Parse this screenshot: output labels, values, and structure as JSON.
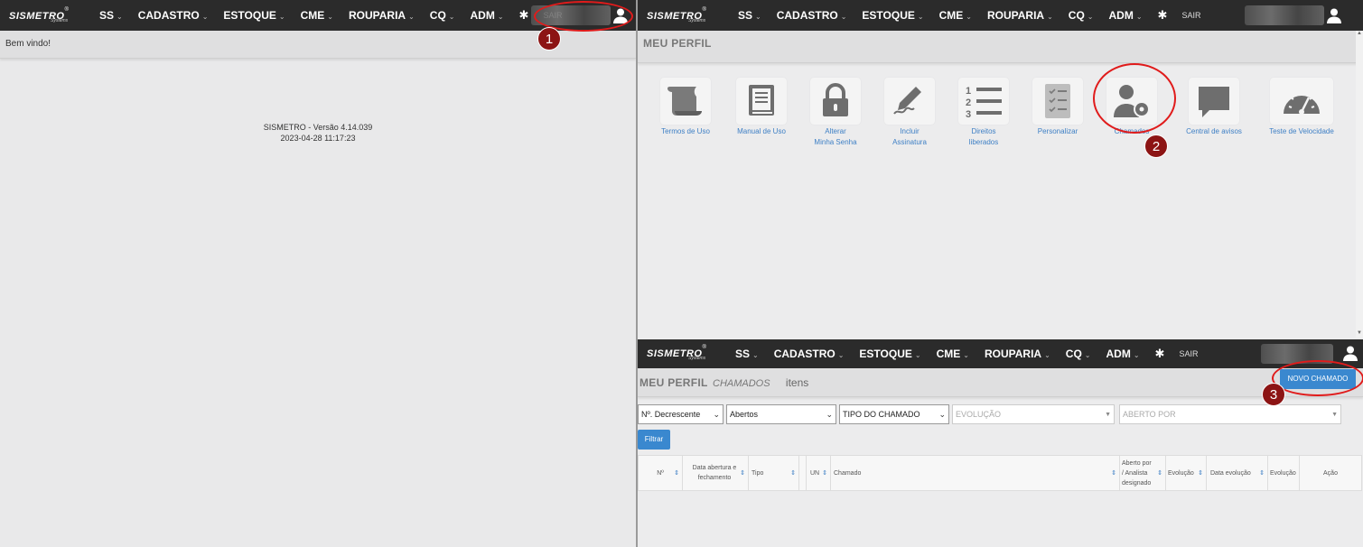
{
  "brand": {
    "name": "SISMETRO",
    "sub": "Systems",
    "reg": "®"
  },
  "nav": {
    "items": [
      "SS",
      "CADASTRO",
      "ESTOQUE",
      "CME",
      "ROUPARIA",
      "CQ",
      "ADM"
    ],
    "logout": "SAIR",
    "caret": "⌄",
    "gear": "✱"
  },
  "panel1": {
    "welcome": "Bem vindo!",
    "version_line1": "SISMETRO - Versão 4.14.039",
    "version_line2": "2023-04-28 11:17:23",
    "badge": "1"
  },
  "panel2": {
    "title": "MEU PERFIL",
    "tiles": [
      {
        "label1": "Termos de Uso",
        "label2": "",
        "icon": "scroll-icon"
      },
      {
        "label1": "Manual de Uso",
        "label2": "",
        "icon": "book-icon"
      },
      {
        "label1": "Alterar",
        "label2": "Minha Senha",
        "icon": "lock-icon"
      },
      {
        "label1": "Incluir",
        "label2": "Assinatura",
        "icon": "pen-icon"
      },
      {
        "label1": "Direitos",
        "label2": "liberados",
        "icon": "numbered-list-icon"
      },
      {
        "label1": "Personalizar",
        "label2": "",
        "icon": "checklist-icon"
      },
      {
        "label1": "Chamados",
        "label2": "",
        "icon": "user-gear-icon"
      },
      {
        "label1": "Central de avisos",
        "label2": "",
        "icon": "speech-bubble-icon"
      },
      {
        "label1": "Teste de Velocidade",
        "label2": "",
        "icon": "speedometer-icon"
      }
    ],
    "badge": "2"
  },
  "panel3": {
    "title": "MEU PERFIL",
    "subtitle": "CHAMADOS",
    "count_label": "itens",
    "new_button": "NOVO CHAMADO",
    "filters": {
      "order": "Nº. Decrescente",
      "status": "Abertos",
      "type": "TIPO DO CHAMADO",
      "evolution_placeholder": "EVOLUÇÃO",
      "opened_by_placeholder": "ABERTO POR"
    },
    "filter_button": "Filtrar",
    "columns": [
      {
        "label": "Nº",
        "sortable": true
      },
      {
        "label": "Data abertura e fechamento",
        "sortable": true
      },
      {
        "label": "Tipo",
        "sortable": true
      },
      {
        "label": "",
        "sortable": false
      },
      {
        "label": "UN",
        "sortable": true
      },
      {
        "label": "Chamado",
        "sortable": true
      },
      {
        "label": "Aberto por / Analista designado",
        "sortable": true
      },
      {
        "label": "Evolução",
        "sortable": true
      },
      {
        "label": "Data evolução",
        "sortable": true
      },
      {
        "label": "Evolução",
        "sortable": false
      },
      {
        "label": "Ação",
        "sortable": false
      }
    ],
    "badge": "3"
  },
  "colors": {
    "accent": "#3a88cf",
    "annotation": "#e01b1b",
    "badge": "#8c1414",
    "topbar": "#2b2b2b"
  }
}
